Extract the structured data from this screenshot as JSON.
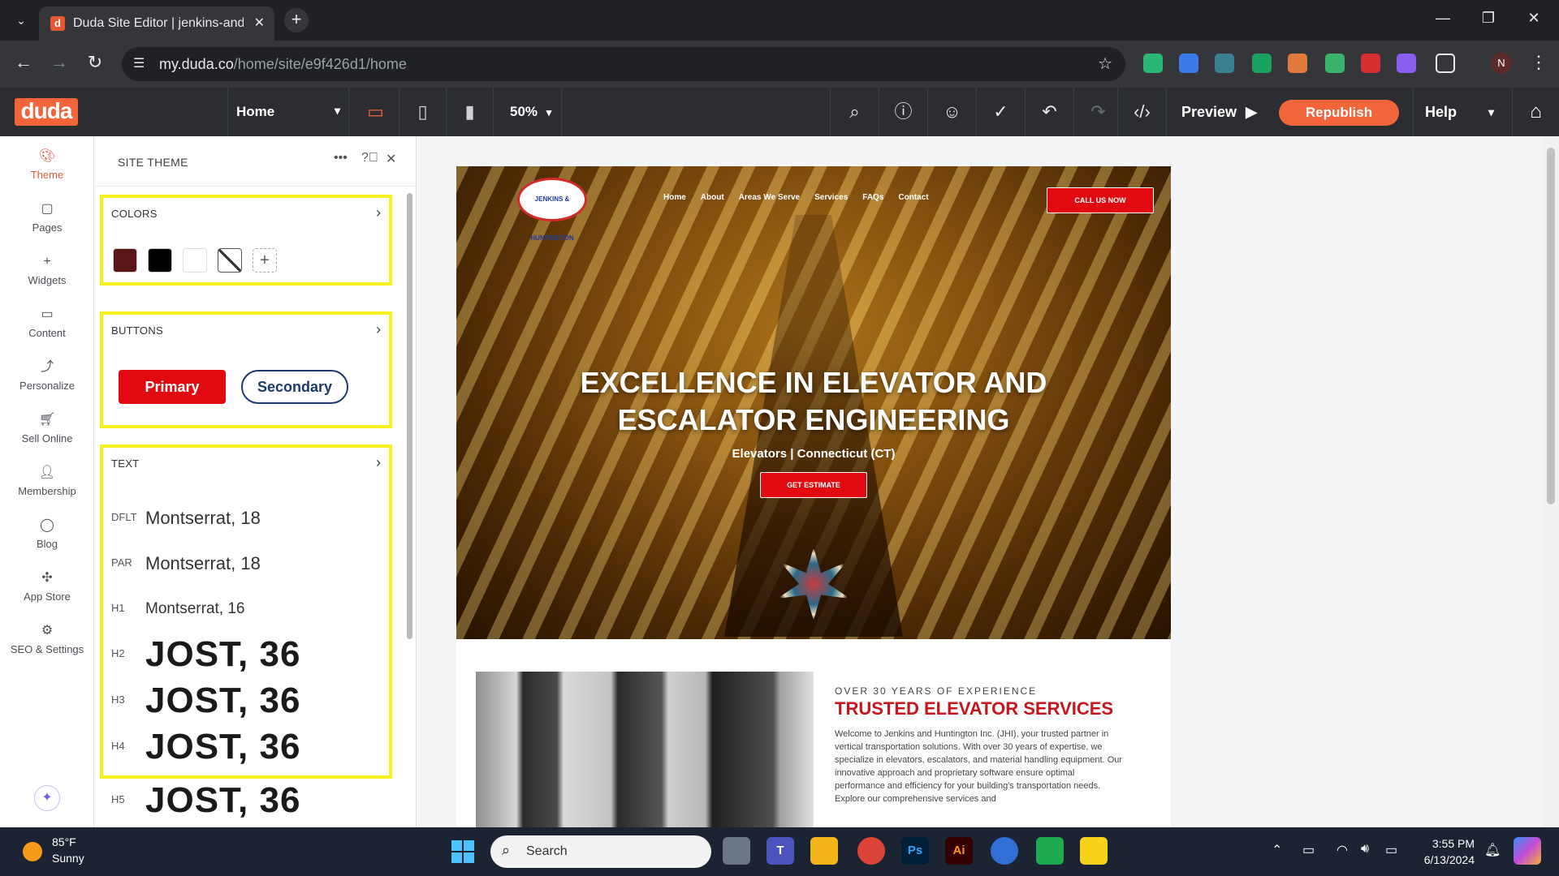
{
  "browser": {
    "tab_title": "Duda Site Editor | jenkins-and-h",
    "favicon_letter": "d",
    "url_host": "my.duda.co",
    "url_path": "/home/site/e9f426d1/home",
    "profile_initial": "N"
  },
  "duda_toolbar": {
    "logo": "duda",
    "page": "Home",
    "zoom": "50%",
    "preview": "Preview",
    "republish": "Republish",
    "help": "Help"
  },
  "sidebar": {
    "items": [
      {
        "label": "Theme",
        "icon": "palette-icon"
      },
      {
        "label": "Pages",
        "icon": "pages-icon"
      },
      {
        "label": "Widgets",
        "icon": "plus-icon"
      },
      {
        "label": "Content",
        "icon": "folder-icon"
      },
      {
        "label": "Personalize",
        "icon": "personalize-icon"
      },
      {
        "label": "Sell Online",
        "icon": "cart-icon"
      },
      {
        "label": "Membership",
        "icon": "user-icon"
      },
      {
        "label": "Blog",
        "icon": "chat-icon"
      },
      {
        "label": "App Store",
        "icon": "puzzle-icon"
      },
      {
        "label": "SEO & Settings",
        "icon": "gear-icon"
      }
    ]
  },
  "theme_panel": {
    "title": "SITE THEME",
    "colors": {
      "title": "COLORS",
      "swatches": [
        "#5a1518",
        "#000000",
        "#ffffff"
      ]
    },
    "buttons": {
      "title": "BUTTONS",
      "primary": "Primary",
      "secondary": "Secondary"
    },
    "text": {
      "title": "TEXT",
      "styles": [
        {
          "tag": "DFLT",
          "sample": "Montserrat, 18"
        },
        {
          "tag": "PAR",
          "sample": "Montserrat, 18"
        },
        {
          "tag": "H1",
          "sample": "Montserrat, 16"
        },
        {
          "tag": "H2",
          "sample": "JOST, 36"
        },
        {
          "tag": "H3",
          "sample": "JOST, 36"
        },
        {
          "tag": "H4",
          "sample": "JOST, 36"
        },
        {
          "tag": "H5",
          "sample": "JOST, 36"
        }
      ]
    }
  },
  "site": {
    "logo_text": "JENKINS & HUNTINGTON",
    "nav": [
      "Home",
      "About",
      "Areas We Serve",
      "Services",
      "FAQs",
      "Contact"
    ],
    "call_button": "CALL US NOW",
    "hero_title": "EXCELLENCE IN ELEVATOR AND ESCALATOR ENGINEERING",
    "hero_subtitle": "Elevators | Connecticut (CT)",
    "estimate_button": "GET ESTIMATE",
    "kicker": "OVER 30 YEARS OF EXPERIENCE",
    "section_title": "TRUSTED ELEVATOR SERVICES",
    "section_body": "Welcome to Jenkins and Huntington Inc. (JHI), your trusted partner in vertical transportation solutions. With over 30 years of expertise, we specialize in elevators, escalators, and material handling equipment. Our innovative approach and proprietary software ensure optimal performance and efficiency for your building's transportation needs. Explore our comprehensive services and"
  },
  "taskbar": {
    "temperature": "85°F",
    "condition": "Sunny",
    "search": "Search",
    "time": "3:55 PM",
    "date": "6/13/2024"
  }
}
